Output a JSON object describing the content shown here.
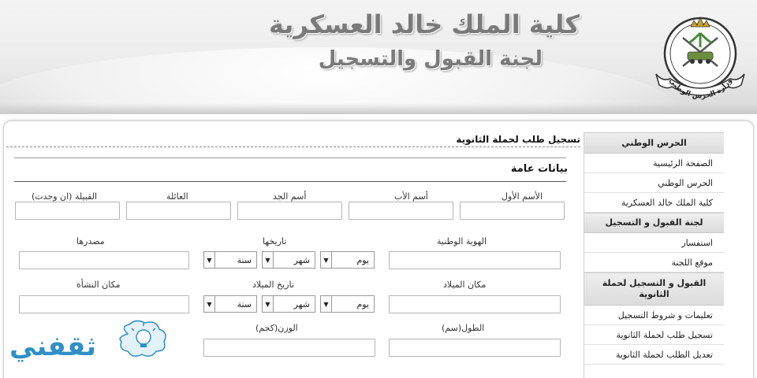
{
  "header": {
    "title_main": "كلية الملك خالد العسكرية",
    "title_sub": "لجنة القبول والتسجيل",
    "emblem_caption": "وزارة الحرس الوطني"
  },
  "page": {
    "title": "تسجيل طلب لحملة الثانوية",
    "section_title": "بيانات عامة"
  },
  "sidebar": {
    "groups": [
      {
        "heading": "الحرس الوطني",
        "items": [
          "الصفحة الرئيسية",
          "الحرس الوطني",
          "كلية الملك خالد العسكرية"
        ]
      },
      {
        "heading": "لجنة القبول و التسجيل",
        "items": [
          "استفسار",
          "موقع اللجنة"
        ]
      },
      {
        "heading": "القبول و التسجيل لحملة الثانوية",
        "items": [
          "تعليمات و شروط التسجيل",
          "تسجيل طلب لحملة الثانوية",
          "تعديل الطلب لحملة الثانوية"
        ]
      }
    ]
  },
  "form": {
    "name_labels": {
      "first": "الأسم الأول",
      "father": "أسم الأب",
      "grandfather": "أسم الجد",
      "family": "العائلة",
      "tribe": "القبيلة (ان وجدت)"
    },
    "national_id": "الهوية الوطنية",
    "id_date": "تاريخها",
    "id_source": "مصدرها",
    "birth_place": "مكان الميلاد",
    "birth_date": "تاريخ الميلاد",
    "origin_place": "مكان النشأة",
    "height": "الطول(سم)",
    "weight": "الوزن(كجم)",
    "day": "يوم",
    "month": "شهر",
    "year": "سنة"
  },
  "watermark": {
    "text": "ثقفني"
  },
  "colors": {
    "watermark": "#2f8fc6",
    "sidebar_heading_bg": "#e3e3e3",
    "header_title": "#7a7a7a"
  }
}
